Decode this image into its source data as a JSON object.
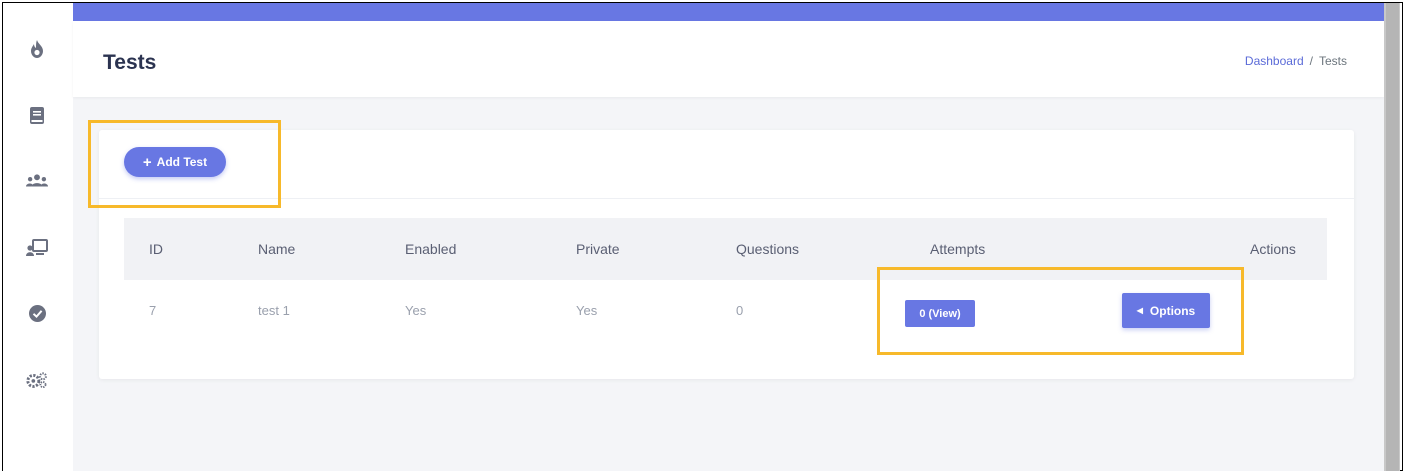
{
  "sidebar": {
    "icons": [
      "flame-icon",
      "book-icon",
      "users-icon",
      "presentation-icon",
      "check-circle-icon",
      "cogs-icon"
    ]
  },
  "header": {
    "title": "Tests",
    "breadcrumb": {
      "link": "Dashboard",
      "separator": "/",
      "current": "Tests"
    }
  },
  "toolbar": {
    "add_label": "Add Test",
    "add_icon": "plus-icon"
  },
  "table": {
    "columns": [
      "ID",
      "Name",
      "Enabled",
      "Private",
      "Questions",
      "Attempts",
      "Actions"
    ],
    "rows": [
      {
        "id": "7",
        "name": "test 1",
        "enabled": "Yes",
        "private": "Yes",
        "questions": "0",
        "attempts_label": "0 (View)",
        "options_label": "Options"
      }
    ]
  },
  "colors": {
    "accent": "#6877e3",
    "highlight": "#f7b92a",
    "title": "#2b3350",
    "sidebar_icon": "#6b7080"
  }
}
